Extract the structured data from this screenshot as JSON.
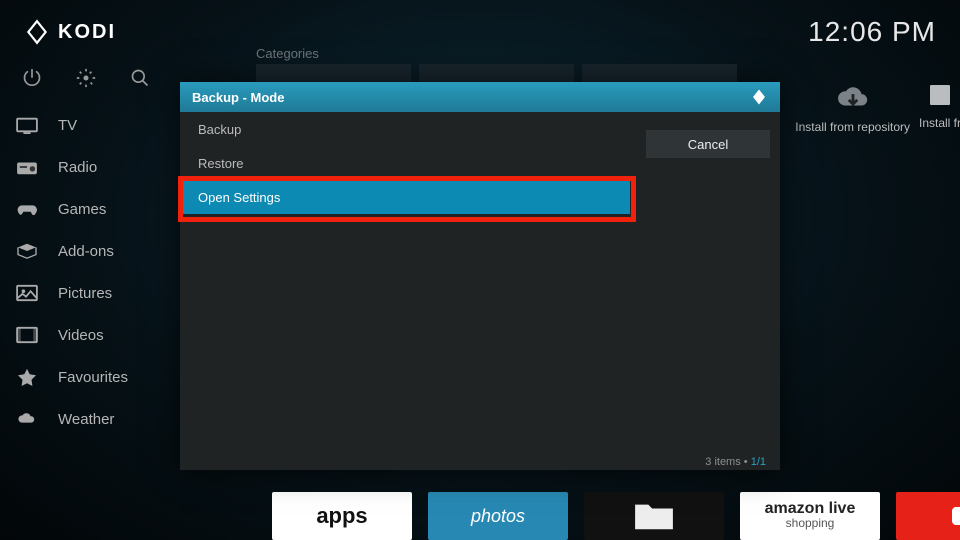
{
  "app": {
    "name": "KODI",
    "clock": "12:06 PM"
  },
  "categories_label": "Categories",
  "sidebar": {
    "items": [
      {
        "label": "TV"
      },
      {
        "label": "Radio"
      },
      {
        "label": "Games"
      },
      {
        "label": "Add-ons"
      },
      {
        "label": "Pictures"
      },
      {
        "label": "Videos"
      },
      {
        "label": "Favourites"
      },
      {
        "label": "Weather"
      }
    ]
  },
  "repo_tiles": {
    "install_from_repo": "Install from repository",
    "install_from": "Install fr"
  },
  "bottom_tiles": {
    "apps": "apps",
    "photos": "photos",
    "amazon_line1": "amazon live",
    "amazon_line2": "shopping"
  },
  "dialog": {
    "title": "Backup - Mode",
    "items": [
      {
        "label": "Backup"
      },
      {
        "label": "Restore"
      },
      {
        "label": "Open Settings"
      }
    ],
    "selected_index": 2,
    "cancel": "Cancel",
    "footer_count": "3 items",
    "footer_page": "1/1"
  }
}
